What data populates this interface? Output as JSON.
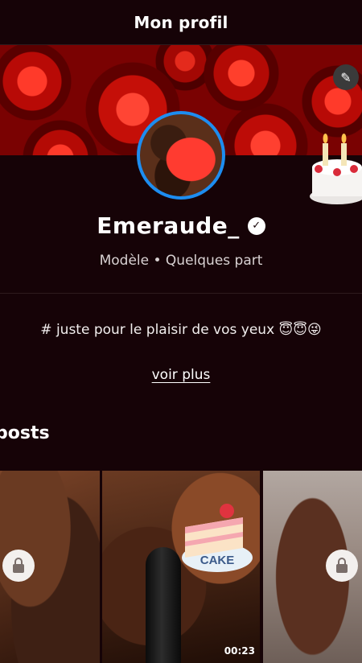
{
  "header": {
    "title": "Mon profil"
  },
  "profile": {
    "name": "Emeraude_",
    "meta": "Modèle • Quelques part",
    "bio": "# juste pour le plaisir de vos yeux 😇😇😜",
    "more_label": "voir plus"
  },
  "posts": {
    "title": "posts",
    "video_duration": "00:23",
    "sticker_text": "CAKE"
  },
  "icons": {
    "edit": "pencil-icon",
    "verified": "check-badge-icon",
    "lock": "lock-icon",
    "cake": "birthday-cake-icon"
  },
  "colors": {
    "background": "#160307",
    "avatar_ring": "#1d8df0"
  }
}
